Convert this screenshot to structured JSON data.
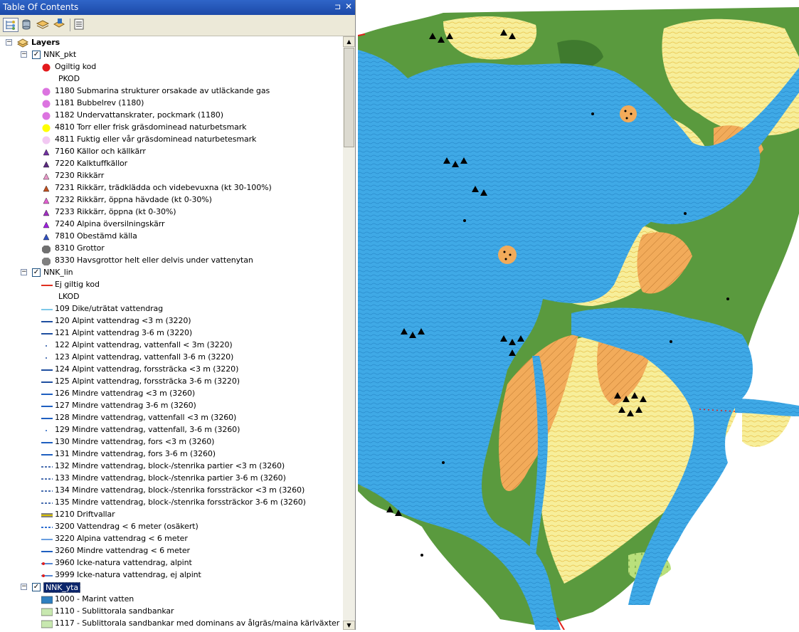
{
  "toc": {
    "title": "Table Of Contents",
    "pin_icon": "♐",
    "close_icon": "✕",
    "toolbar": [
      "list-by-drawing-order-icon",
      "list-by-source-icon",
      "list-by-visibility-icon",
      "list-by-selection-icon",
      "options-icon"
    ],
    "root_label": "Layers",
    "layers": [
      {
        "name": "NNK_pkt",
        "checked": true,
        "heading": "PKOD",
        "null_item": {
          "label": "Ogiltig kod",
          "symbol": "dot",
          "color": "#e31a1c"
        },
        "items": [
          {
            "label": "1180 Submarina strukturer orsakade av utläckande gas",
            "symbol": "dot",
            "color": "#dc74e0"
          },
          {
            "label": "1181 Bubbelrev (1180)",
            "symbol": "dot",
            "color": "#dc74e0"
          },
          {
            "label": "1182 Undervattanskrater, pockmark (1180)",
            "symbol": "dot",
            "color": "#dc74e0"
          },
          {
            "label": "4810 Torr eller frisk gräsdominead naturbetsmark",
            "symbol": "dot",
            "color": "#ffff00"
          },
          {
            "label": "4811 Fuktig eller vår gräsdominead naturbetesmark",
            "symbol": "dot",
            "color": "#f2c8f2"
          },
          {
            "label": "7160 Källor och källkärr",
            "symbol": "tri",
            "color": "#7030a0"
          },
          {
            "label": "7220 Kalktuffkällor",
            "symbol": "tri",
            "color": "#5a2a80"
          },
          {
            "label": "7230 Rikkärr",
            "symbol": "tri",
            "color": "#e898c8"
          },
          {
            "label": "7231 Rikkärr, trädklädda och videbevuxna (kt 30-100%)",
            "symbol": "tri",
            "color": "#c05020"
          },
          {
            "label": "7232 Rikkärr, öppna hävdade (kt 0-30%)",
            "symbol": "tri",
            "color": "#e060d0"
          },
          {
            "label": "7233 Rikkärr, öppna (kt 0-30%)",
            "symbol": "tri",
            "color": "#a030c0"
          },
          {
            "label": "7240 Alpina översilningskärr",
            "symbol": "tri",
            "color": "#a020e0"
          },
          {
            "label": "7810 Obestämd källa",
            "symbol": "tri",
            "color": "#3050c0"
          },
          {
            "label": "8310 Grottor",
            "symbol": "oct",
            "color": "#707070"
          },
          {
            "label": "8330 Havsgrottor helt eller delvis under vattenytan",
            "symbol": "oct",
            "color": "#808080"
          }
        ]
      },
      {
        "name": "NNK_lin",
        "checked": true,
        "heading": "LKOD",
        "null_item": {
          "label": "Ej giltig kod",
          "symbol": "line",
          "color": "#e03020"
        },
        "items": [
          {
            "label": "109 Dike/uträtat vattendrag",
            "symbol": "line",
            "color": "#7ec8e8"
          },
          {
            "label": "120 Alpint vattendrag <3 m (3220)",
            "symbol": "line",
            "color": "#1f4fa0"
          },
          {
            "label": "121 Alpint vattendrag 3-6 m (3220)",
            "symbol": "line",
            "color": "#1f4fa0"
          },
          {
            "label": "122 Alpint vattendrag, vattenfall < 3m (3220)",
            "symbol": "dots",
            "color": "#1f4fa0"
          },
          {
            "label": "123 Alpint vattendrag, vattenfall  3-6 m (3220)",
            "symbol": "dots",
            "color": "#1f4fa0"
          },
          {
            "label": "124 Alpint vattendrag, forssträcka <3 m (3220)",
            "symbol": "line",
            "color": "#1f4fa0"
          },
          {
            "label": "125 Alpint vattendrag, forssträcka 3-6 m (3220)",
            "symbol": "line",
            "color": "#1f4fa0"
          },
          {
            "label": "126 Mindre vattendrag <3 m (3260)",
            "symbol": "line",
            "color": "#1f5fc0"
          },
          {
            "label": "127 Mindre vattendrag 3-6 m (3260)",
            "symbol": "line",
            "color": "#1f5fc0"
          },
          {
            "label": "128 Mindre vattendrag, vattenfall <3 m (3260)",
            "symbol": "line",
            "color": "#1f5fc0"
          },
          {
            "label": "129 Mindre vattendrag, vattenfall, 3-6 m (3260)",
            "symbol": "dots",
            "color": "#1f5fc0"
          },
          {
            "label": "130 Mindre vattendrag, fors <3 m (3260)",
            "symbol": "line",
            "color": "#1f5fc0"
          },
          {
            "label": "131 Mindre vattendrag, fors 3-6 m (3260)",
            "symbol": "line",
            "color": "#1f5fc0"
          },
          {
            "label": "132 Mindre vattendrag, block-/stenrika partier <3 m (3260)",
            "symbol": "dash",
            "color": "#4a6fb0"
          },
          {
            "label": "133 Mindre vattendrag, block-/stenrika partier 3-6 m (3260)",
            "symbol": "dash",
            "color": "#4a6fb0"
          },
          {
            "label": "134 Mindre vattendrag, block-/stenrika forssträckor <3 m (3260)",
            "symbol": "dash",
            "color": "#4a6fb0"
          },
          {
            "label": "135 Mindre vattendrag, block-/stenrika forssträckor 3-6 m (3260)",
            "symbol": "dash",
            "color": "#4a6fb0"
          },
          {
            "label": "1210 Driftvallar",
            "symbol": "double",
            "color": "#d8c000"
          },
          {
            "label": "3200 Vattendrag < 6 meter (osäkert)",
            "symbol": "dash",
            "color": "#2f6fd0"
          },
          {
            "label": "3220 Alpina vattendrag < 6 meter",
            "symbol": "line",
            "color": "#6a9fe0"
          },
          {
            "label": "3260 Mindre vattendrag < 6 meter",
            "symbol": "line",
            "color": "#1f5fc0"
          },
          {
            "label": "3960 Icke-natura vattendrag, alpint",
            "symbol": "dotline",
            "color": "#e02020"
          },
          {
            "label": "3999 Icke-natura vattendrag, ej alpint",
            "symbol": "dotline",
            "color": "#e02020"
          }
        ]
      },
      {
        "name": "NNK_yta",
        "checked": true,
        "selected": true,
        "items": [
          {
            "label": "1000 - Marint vatten",
            "symbol": "patch",
            "color": "#2f7fbf"
          },
          {
            "label": "1110 - Sublittorala sandbankar",
            "symbol": "patch",
            "color": "#c8e8b0"
          },
          {
            "label": "1117 - Sublittorala sandbankar med dominans av ålgräs/maina kärlväxter",
            "symbol": "patch",
            "color": "#c8e8b0"
          }
        ]
      }
    ]
  },
  "map": {
    "colors": {
      "water": "#3fa9e6",
      "forest": "#5a9a3e",
      "dark_forest": "#3f7a2e",
      "sand": "#f7ee9a",
      "meadow": "#b9e07c",
      "orange": "#f2ab5a",
      "line_red": "#e0201c"
    }
  }
}
